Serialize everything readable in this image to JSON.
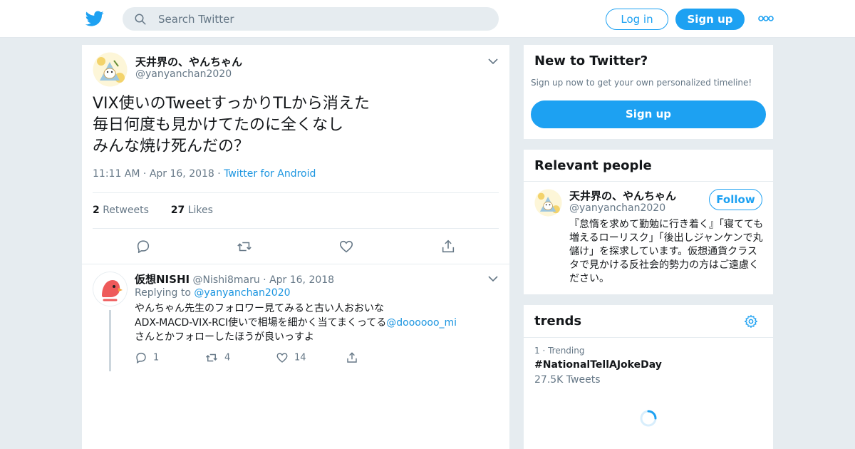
{
  "header": {
    "search_placeholder": "Search Twitter",
    "login_label": "Log in",
    "signup_label": "Sign up"
  },
  "tweet": {
    "author_name": "天井界の、やんちゃん",
    "author_handle": "@yanyanchan2020",
    "text_lines": [
      "VIX使いのTweetすっかりTLから消えた",
      "毎日何度も見かけてたのに全くなし",
      "みんな焼け死んだの？"
    ],
    "time": "11:11 AM",
    "date": "Apr 16, 2018",
    "source": "Twitter for Android",
    "retweets_count": "2",
    "retweets_label": "Retweets",
    "likes_count": "27",
    "likes_label": "Likes"
  },
  "reply": {
    "author_name": "仮想NISHI",
    "author_handle": "@Nishi8maru",
    "date": "Apr 16, 2018",
    "replying_prefix": "Replying to",
    "replying_to": "@yanyanchan2020",
    "line1": "やんちゃん先生のフォロワー見てみると古い人おおいな",
    "line2": "ADX-MACD-VIX-RCI使いで相場を細かく当てまくってる",
    "line2_mention": "@doooooo_mi",
    "line3": "さんとかフォローしたほうが良いっすよ",
    "replies": "1",
    "retweets": "4",
    "likes": "14"
  },
  "new_to_twitter": {
    "title": "New to Twitter?",
    "subtitle": "Sign up now to get your own personalized timeline!",
    "signup_label": "Sign up"
  },
  "relevant_people": {
    "title": "Relevant people",
    "name": "天井界の、やんちゃん",
    "handle": "@yanyanchan2020",
    "follow_label": "Follow",
    "bio": "『怠惰を求めて勤勉に行き着く』「寝てても増えるローリスク」「後出しジャンケンで丸儲け」を探求しています。仮想通貨クラスタで見かける反社会的勢力の方はご遠慮ください。"
  },
  "trends": {
    "title": "trends",
    "rank_label": "1 · Trending",
    "name": "#NationalTellAJokeDay",
    "count": "27.5K Tweets"
  },
  "colors": {
    "brand": "#1da1f2",
    "link": "#1b95e0",
    "secondary_text": "#657786",
    "background": "#e6ecf0"
  }
}
